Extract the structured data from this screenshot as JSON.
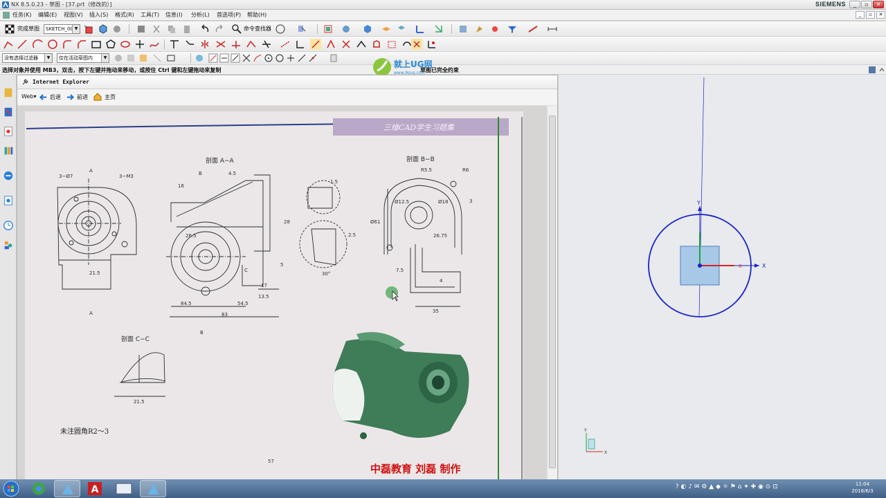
{
  "app": {
    "title": "NX 8.5.0.23 - 草图 - [37.prt（修改的）]",
    "brand": "SIEMENS",
    "window_controls": [
      "_",
      "▫",
      "✕"
    ]
  },
  "menu": {
    "items": [
      "任务(K)",
      "编辑(E)",
      "视图(V)",
      "插入(S)",
      "格式(R)",
      "工具(T)",
      "信息(I)",
      "分析(L)",
      "首选项(P)",
      "帮助(H)"
    ],
    "sub_controls": [
      "_",
      "▫",
      "✕"
    ]
  },
  "toolbar": {
    "finish_sketch": "完成草图",
    "sketch_name": "SKETCH_000",
    "command_finder": "命令查找器"
  },
  "selection_bar": {
    "filter": "没有选择过滤器",
    "scope": "仅在活动草图内"
  },
  "cue": {
    "text": "选择对象并使用 MB3，双击，按下左键并拖动来移动，或按住 Ctrl 键和左键拖动来复制",
    "status": "草图已完全约束"
  },
  "watermark": {
    "title": "就上UG网",
    "url": "www.9sug.com"
  },
  "ie": {
    "title": "Internet Explorer",
    "web": "Web",
    "back": "后退",
    "forward": "前进",
    "home": "主页"
  },
  "page": {
    "header": "三维CAD学生习题集",
    "section_aa": "剖面  A−A",
    "section_bb": "剖面  B−B",
    "section_cc": "剖面  C−C",
    "note": "未注圆角R2～3",
    "page_number": "57",
    "credit": "中磊教育  刘磊  制作",
    "marks": {
      "a_top": "A",
      "a_bottom": "A",
      "b_top": "B",
      "b_bottom": "B",
      "c": "C",
      "holes7": "3−Ø7",
      "holes_m3": "3−M3",
      "d21_5": "21.5",
      "d16": "16",
      "d4_5": "4.5",
      "d26_5": "26.5",
      "d28": "28",
      "d5": "5",
      "d54_5": "54.5",
      "d84_5": "84.5",
      "d83": "83",
      "d17": "17",
      "d13_5": "13.5",
      "d2_5": "2.5",
      "d30": "30°",
      "r5_5": "R5.5",
      "r6": "R6",
      "d61": "Ø61",
      "d12_5": "Ø12.5",
      "d18": "Ø18",
      "d26_75": "26.75",
      "d35": "35",
      "d7_5": "7.5",
      "d3": "3",
      "d4": "4",
      "d1_5": "1.5"
    }
  },
  "graphics": {
    "axes": {
      "x": "X",
      "y": "Y"
    }
  },
  "taskbar": {
    "clock_time": "11:04",
    "clock_date": "2018/6/3"
  },
  "colors": {
    "sketch_circle": "#1a23c8",
    "sketch_square_fill": "#a8c8e8",
    "axis_x": "#d42424",
    "axis_y": "#1fa23a",
    "axis_z": "#1a23c8",
    "page_header": "#b9a8c7",
    "credit": "#d01010"
  }
}
